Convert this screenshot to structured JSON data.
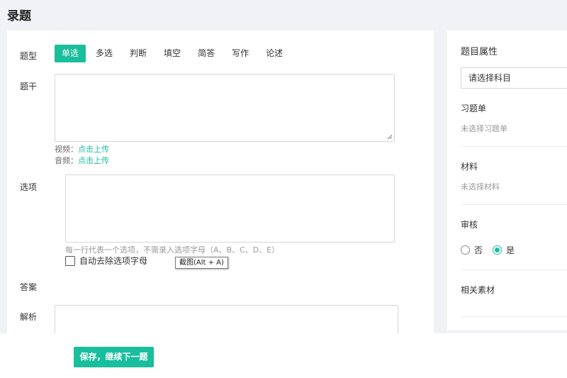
{
  "page": {
    "title": "录题"
  },
  "form": {
    "type_label": "题型",
    "types": [
      "单选",
      "多选",
      "判断",
      "填空",
      "简答",
      "写作",
      "论述"
    ],
    "active_type": "单选",
    "stem_label": "题干",
    "video_label": "视频：",
    "video_link": "点击上传",
    "audio_label": "音频：",
    "audio_link": "点击上传",
    "options_label": "选项",
    "options_hint": "每一行代表一个选项，不需录入选项字母（A、B、C、D、E）",
    "auto_remove_label": "自动去除选项字母",
    "answer_label": "答案",
    "analysis_label": "解析",
    "save_button": "保存，继续下一题"
  },
  "tooltip": {
    "text": "截图(Alt + A)"
  },
  "sidebar": {
    "title": "题目属性",
    "subject_select": "请选择科目",
    "exercise_label": "习题单",
    "exercise_value": "未选择习题单",
    "material_label": "材料",
    "material_value": "未选择材料",
    "review_label": "审核",
    "review_options": [
      "否",
      "是"
    ],
    "review_selected": "是",
    "related_label": "相关素材"
  },
  "colors": {
    "accent": "#19be9c",
    "background": "#f0f2f5"
  }
}
